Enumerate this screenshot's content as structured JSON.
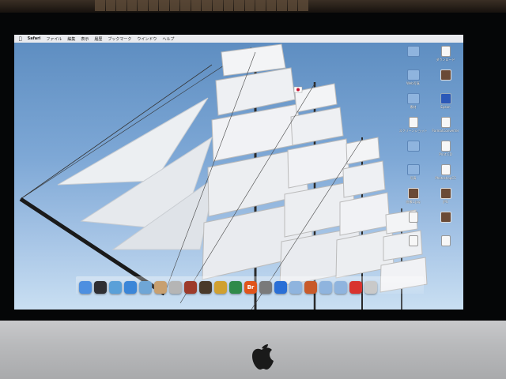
{
  "menubar": {
    "apple_icon": "apple-logo-icon",
    "app_name": "Safari",
    "items": [
      "ファイル",
      "編集",
      "表示",
      "履歴",
      "ブックマーク",
      "ウインドウ",
      "ヘルプ"
    ]
  },
  "desktop_icons": [
    {
      "type": "folder",
      "label": ""
    },
    {
      "type": "doc",
      "label": "ダウンロード"
    },
    {
      "type": "folder",
      "label": "Web写真"
    },
    {
      "type": "img",
      "label": ""
    },
    {
      "type": "folder",
      "label": "素材"
    },
    {
      "type": "app",
      "label": "Epson"
    },
    {
      "type": "doc",
      "label": "スクリーンショット"
    },
    {
      "type": "doc",
      "label": "FormatConverter"
    },
    {
      "type": "folder",
      "label": ""
    },
    {
      "type": "doc",
      "label": "Print CD"
    },
    {
      "type": "folder",
      "label": "写真"
    },
    {
      "type": "doc",
      "label": "PhotoshopCS"
    },
    {
      "type": "img",
      "label": "画像1.jpg"
    },
    {
      "type": "img",
      "label": "JPG"
    },
    {
      "type": "doc",
      "label": ""
    },
    {
      "type": "img",
      "label": ""
    },
    {
      "type": "doc",
      "label": ""
    },
    {
      "type": "doc",
      "label": ""
    }
  ],
  "dock": [
    {
      "name": "finder",
      "color": "#4d8fe0",
      "label": ""
    },
    {
      "name": "dashboard",
      "color": "#2f2f33",
      "label": ""
    },
    {
      "name": "preview",
      "color": "#5aa0d8",
      "label": ""
    },
    {
      "name": "safari",
      "color": "#3b86d8",
      "label": ""
    },
    {
      "name": "mail",
      "color": "#6fa6d6",
      "label": ""
    },
    {
      "name": "address-book",
      "color": "#c8a070",
      "label": ""
    },
    {
      "name": "photo",
      "color": "#b5b5b5",
      "label": ""
    },
    {
      "name": "iphoto",
      "color": "#9d3b2b",
      "label": ""
    },
    {
      "name": "app-dark",
      "color": "#4a3a2a",
      "label": ""
    },
    {
      "name": "aperture",
      "color": "#d0a030",
      "label": ""
    },
    {
      "name": "time-machine",
      "color": "#2f8a4a",
      "label": ""
    },
    {
      "name": "bridge",
      "color": "#e0541b",
      "label": "Br"
    },
    {
      "name": "preferences",
      "color": "#7a7a7a",
      "label": ""
    },
    {
      "name": "app-store",
      "color": "#2a6fd6",
      "label": ""
    },
    {
      "name": "folder-apps",
      "color": "#8fb4de",
      "label": ""
    },
    {
      "name": "folder-docs",
      "color": "#c85a2a",
      "label": ""
    },
    {
      "name": "folder-downloads",
      "color": "#8fb4de",
      "label": ""
    },
    {
      "name": "folder-2",
      "color": "#8fb4de",
      "label": ""
    },
    {
      "name": "stop-app",
      "color": "#d8332f",
      "label": ""
    },
    {
      "name": "trash",
      "color": "#c9c9c9",
      "label": ""
    }
  ]
}
